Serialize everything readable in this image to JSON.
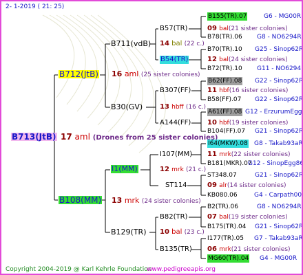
{
  "header": "2-   1-2019  (  21:  25)",
  "footer_left": "Copyright 2004-2019 @ Karl Kehrle Foundation",
  "footer_right": "www.pedigreeapis.org",
  "root": {
    "name": "B713(JtB)",
    "num": "17",
    "type": "aml",
    "note": "(Drones from 25 sister colonies)"
  },
  "gen1": [
    {
      "name": "B712(JtB)",
      "num": "16",
      "type": "aml",
      "note": "(25 sister colonies)"
    },
    {
      "name": "B108(MM)",
      "num": "13",
      "type": "mrk",
      "note": "(24 sister colonies)"
    }
  ],
  "gen2": [
    {
      "name": "B711(vdB)",
      "num": "14",
      "type": "bal",
      "note": "(22 c.)"
    },
    {
      "name": "B30(GV)",
      "num": "13",
      "type": "hbff",
      "note": "(16 c.)"
    },
    {
      "name": "I1(MM)",
      "num": "12",
      "type": "mrk",
      "note": "(21 c.)"
    },
    {
      "name": "B129(TR)",
      "num": "10",
      "type": "bal",
      "note": "(23 c.)"
    }
  ],
  "gen3": [
    {
      "name": "B57(TR)",
      "num": "09",
      "type": "bal",
      "note": "(21 sister colonies)"
    },
    {
      "name": "B54(TR)",
      "num": "12",
      "type": "bal",
      "note": "(24 sister colonies)"
    },
    {
      "name": "B307(FF)",
      "num": "11",
      "type": "hbf",
      "note": "(16 sister colonies)"
    },
    {
      "name": "A144(FF)",
      "num": "10",
      "type": "hbf",
      "note": "(19 sister colonies)"
    },
    {
      "name": "I107(MM)",
      "num": "11",
      "type": "mrk",
      "note": "(22 sister colonies)"
    },
    {
      "name": "ST114",
      "num": "09",
      "type": "alr",
      "note": "(14 sister colonies)"
    },
    {
      "name": "B82(TR)",
      "num": "07",
      "type": "bal",
      "note": "(19 sister colonies)"
    },
    {
      "name": "B135(TR)",
      "num": "06",
      "type": "mrk",
      "note": "(21 sister colonies)"
    }
  ],
  "gen4": [
    {
      "name": "B155(TR).07",
      "info": "G6 - MG00R"
    },
    {
      "name": "B78(TR).06",
      "info": "G8 - NO6294R"
    },
    {
      "name": "B70(TR).10",
      "info": "G25 - Sinop62R"
    },
    {
      "name": "B72(TR).10",
      "info": "G11 - NO6294R"
    },
    {
      "name": "B62(FF).08",
      "info": "G22 - Sinop62R"
    },
    {
      "name": "B58(FF).07",
      "info": "G22 - Sinop62R"
    },
    {
      "name": "A61(FF).08",
      "info": "G12 - ErzurumEgg88"
    },
    {
      "name": "B104(FF).07",
      "info": "G21 - Sinop62R"
    },
    {
      "name": "I64(MKW).08",
      "info": "G8 - Takab93aR"
    },
    {
      "name": "B181(MKR).07",
      "info": "G12 - SinopEgg86R"
    },
    {
      "name": "ST348.07",
      "info": "G21 - Sinop62R"
    },
    {
      "name": "KB080.06",
      "info": "G4 - Carpath00R"
    },
    {
      "name": "B2(TR).06",
      "info": "G8 - NO6294R"
    },
    {
      "name": "B175(TR).04",
      "info": "G21 - Sinop62R"
    },
    {
      "name": "I177(TR).05",
      "info": "G7 - Takab93aR"
    },
    {
      "name": "MG60(TR).04",
      "info": "G4 - MG00R"
    }
  ],
  "colors": {
    "frame": "#e24ad8",
    "green": "#33dd33",
    "cyan": "#33dddd",
    "gray": "#a0a0a0",
    "yellow": "#ffff00",
    "pink": "#f2b8ee",
    "blue": "#1818c8",
    "purple": "#6e2b8a"
  }
}
